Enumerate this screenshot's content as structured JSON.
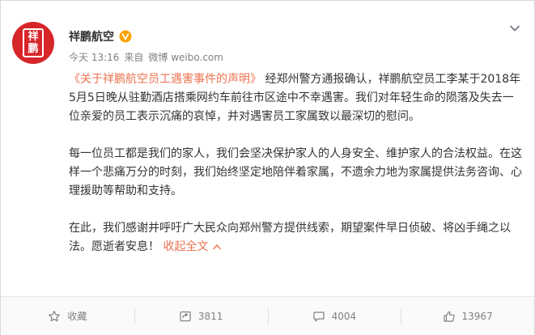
{
  "post": {
    "avatar_text": [
      "祥",
      "鹏"
    ],
    "username": "祥鹏航空",
    "time": "今天 13:16",
    "from_label": "来自",
    "source": "微博 weibo.com",
    "link_title": "《关于祥鹏航空员工遇害事件的声明》",
    "para1_rest": " 经郑州警方通报确认，祥鹏航空员工李某于2018年5月5日晚从驻勤酒店搭乘网约车前往市区途中不幸遇害。我们对年轻生命的陨落及失去一位亲爱的员工表示沉痛的哀悼，并对遇害员工家属致以最深切的慰问。",
    "para2": "每一位员工都是我们的家人，我们会坚决保护家人的人身安全、维护家人的合法权益。在这样一个悲痛万分的时刻，我们始终坚定地陪伴着家属，不遗余力地为家属提供法务咨询、心理援助等帮助和支持。",
    "para3": "在此，我们感谢并呼吁广大民众向郑州警方提供线索，期望案件早日侦破、将凶手绳之以法。愿逝者安息！",
    "collapse_label": "收起全文"
  },
  "actions": {
    "favorite_label": "收藏",
    "repost_count": "3811",
    "comment_count": "4004",
    "like_count": "13967"
  },
  "colors": {
    "accent": "#eb7350",
    "avatar_bg": "#d7262a",
    "verified": "#ffa200"
  }
}
